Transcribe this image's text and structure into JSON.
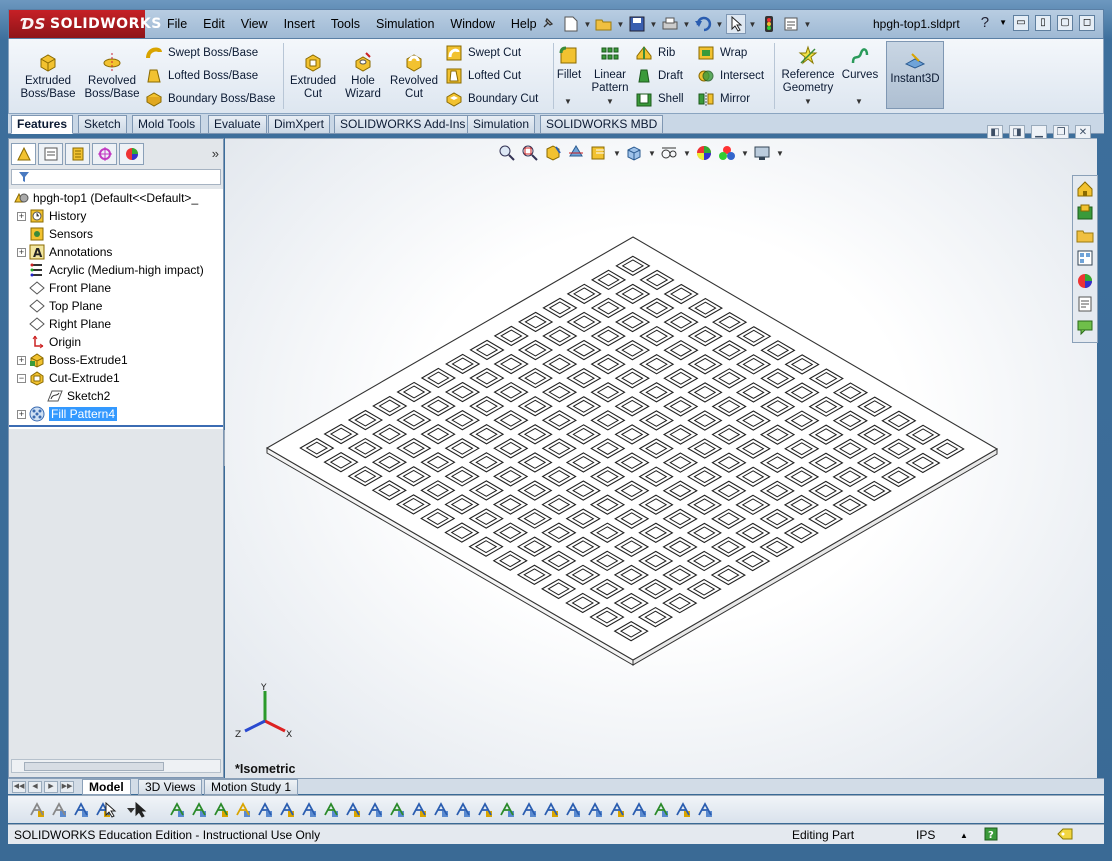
{
  "app": {
    "logo": "SOLIDWORKS",
    "document_name": "hpgh-top1.sldprt"
  },
  "menu": [
    "File",
    "Edit",
    "View",
    "Insert",
    "Tools",
    "Simulation",
    "Window",
    "Help"
  ],
  "commands": {
    "extruded_boss": "Extruded Boss/Base",
    "revolved_boss": "Revolved Boss/Base",
    "swept_boss": "Swept Boss/Base",
    "lofted_boss": "Lofted Boss/Base",
    "boundary_boss": "Boundary Boss/Base",
    "extruded_cut": "Extruded Cut",
    "hole_wizard": "Hole Wizard",
    "revolved_cut": "Revolved Cut",
    "swept_cut": "Swept Cut",
    "lofted_cut": "Lofted Cut",
    "boundary_cut": "Boundary Cut",
    "fillet": "Fillet",
    "linear_pattern": "Linear Pattern",
    "rib": "Rib",
    "draft": "Draft",
    "shell": "Shell",
    "wrap": "Wrap",
    "intersect": "Intersect",
    "mirror": "Mirror",
    "reference_geometry": "Reference Geometry",
    "curves": "Curves",
    "instant3d": "Instant3D"
  },
  "tabs": [
    "Features",
    "Sketch",
    "Mold Tools",
    "Evaluate",
    "DimXpert",
    "SOLIDWORKS Add-Ins",
    "Simulation",
    "SOLIDWORKS MBD"
  ],
  "feature_tree": {
    "root": "hpgh-top1  (Default<<Default>_",
    "items": [
      {
        "label": "History",
        "expand": "+"
      },
      {
        "label": "Sensors",
        "expand": ""
      },
      {
        "label": "Annotations",
        "expand": "+"
      },
      {
        "label": "Acrylic (Medium-high impact)",
        "expand": ""
      },
      {
        "label": "Front Plane",
        "expand": ""
      },
      {
        "label": "Top Plane",
        "expand": ""
      },
      {
        "label": "Right Plane",
        "expand": ""
      },
      {
        "label": "Origin",
        "expand": ""
      },
      {
        "label": "Boss-Extrude1",
        "expand": "+"
      },
      {
        "label": "Cut-Extrude1",
        "expand": "−"
      },
      {
        "label": "Sketch2",
        "expand": ""
      },
      {
        "label": "Fill Pattern4",
        "expand": "+"
      }
    ]
  },
  "viewport": {
    "view_label": "*Isometric",
    "triad": {
      "x": "X",
      "y": "Y",
      "z": "Z"
    },
    "grid_rows": 14,
    "grid_cols": 14
  },
  "bottom_tabs": [
    "Model",
    "3D Views",
    "Motion Study 1"
  ],
  "status": {
    "edition": "SOLIDWORKS Education Edition - Instructional Use Only",
    "mode": "Editing Part",
    "units": "IPS"
  },
  "colors": {
    "logo_red": "#c62026",
    "selection_blue": "#3399ff",
    "chrome_blue": "#3d6f9c"
  }
}
